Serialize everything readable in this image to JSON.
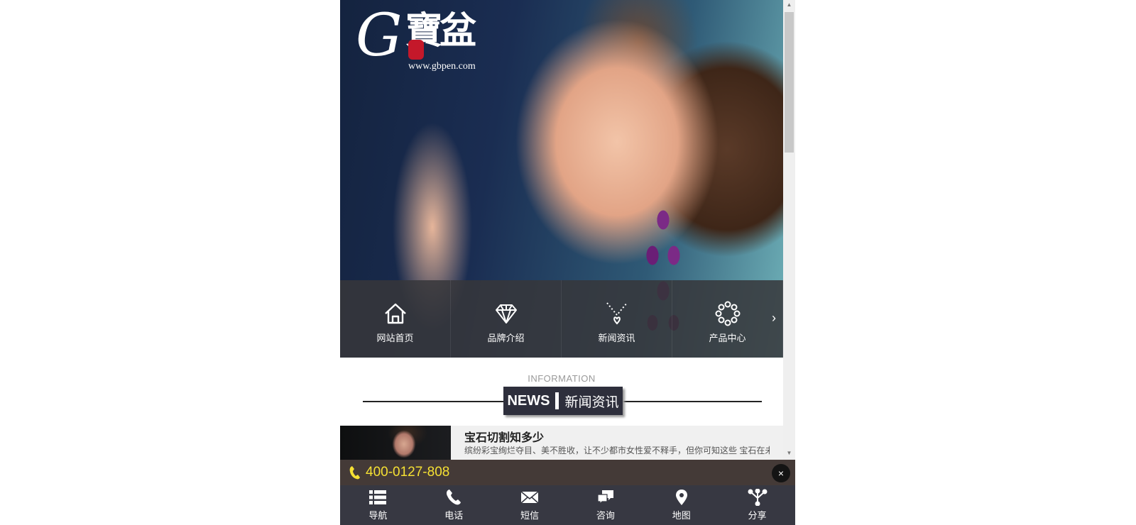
{
  "hero": {
    "logo_mark": "G",
    "logo_text": "寶盆",
    "url": "www.gbpen.com"
  },
  "nav": {
    "items": [
      {
        "label": "网站首页",
        "icon": "home-icon"
      },
      {
        "label": "品牌介绍",
        "icon": "diamond-icon"
      },
      {
        "label": "新闻资讯",
        "icon": "necklace-icon"
      },
      {
        "label": "产品中心",
        "icon": "bracelet-icon"
      }
    ],
    "next": "›"
  },
  "section": {
    "info_label": "INFORMATION",
    "news_en": "NEWS",
    "news_cn": "新闻资讯"
  },
  "news": [
    {
      "title": "宝石切割知多少",
      "desc": "缤纷彩宝绚烂夺目、美不胜收，让不少都市女性爱不释手，但你可知这些 宝石在未"
    }
  ],
  "contact": {
    "phone": "400-0127-808",
    "close": "×"
  },
  "toolbar": {
    "items": [
      {
        "label": "导航",
        "icon": "list-icon"
      },
      {
        "label": "电话",
        "icon": "phone-icon"
      },
      {
        "label": "短信",
        "icon": "mail-icon"
      },
      {
        "label": "咨询",
        "icon": "chat-icon"
      },
      {
        "label": "地图",
        "icon": "map-pin-icon"
      },
      {
        "label": "分享",
        "icon": "share-icon"
      }
    ]
  },
  "colors": {
    "phone_bar_bg": "#443a37",
    "phone_number": "#f5e033",
    "toolbar_bg": "#373842",
    "news_badge_bg": "#2e2f3c"
  }
}
